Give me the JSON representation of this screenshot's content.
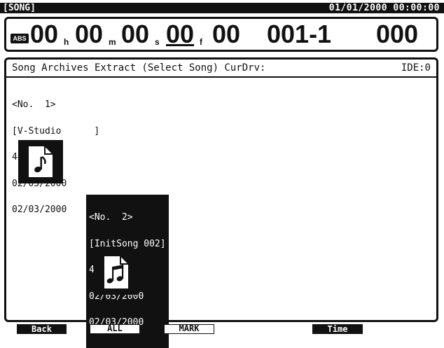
{
  "topbar": {
    "screen_tag": "[SONG]",
    "datetime": "01/01/2000 00:00:00"
  },
  "counter": {
    "abs_label": "ABS",
    "hours": "00",
    "hours_unit": "h",
    "minutes": "00",
    "minutes_unit": "m",
    "seconds": "00",
    "seconds_unit": "s",
    "frames": "00",
    "frames_unit": "f",
    "subframes": "00",
    "measure_beat": "001-1",
    "tick": "000"
  },
  "header": {
    "title": "Song Archives Extract (Select Song) CurDrv:",
    "drive": "IDE:0"
  },
  "songs": [
    {
      "number": "<No.  1>",
      "name": "[V-Studio      ]",
      "format": "44.1k MT2",
      "date1": "02/03/2000",
      "date2": "02/03/2000",
      "icon": "single-note-icon",
      "selected": false
    },
    {
      "number": "<No.  2>",
      "name": "[InitSong 002]",
      "format": "44.1k MT1",
      "date1": "02/03/2000",
      "date2": "02/03/2000",
      "icon": "double-note-icon",
      "selected": true
    }
  ],
  "function_keys": {
    "f1": "Back",
    "f2": "ALL",
    "f3": "MARK",
    "f4": "",
    "f5": "Time"
  }
}
